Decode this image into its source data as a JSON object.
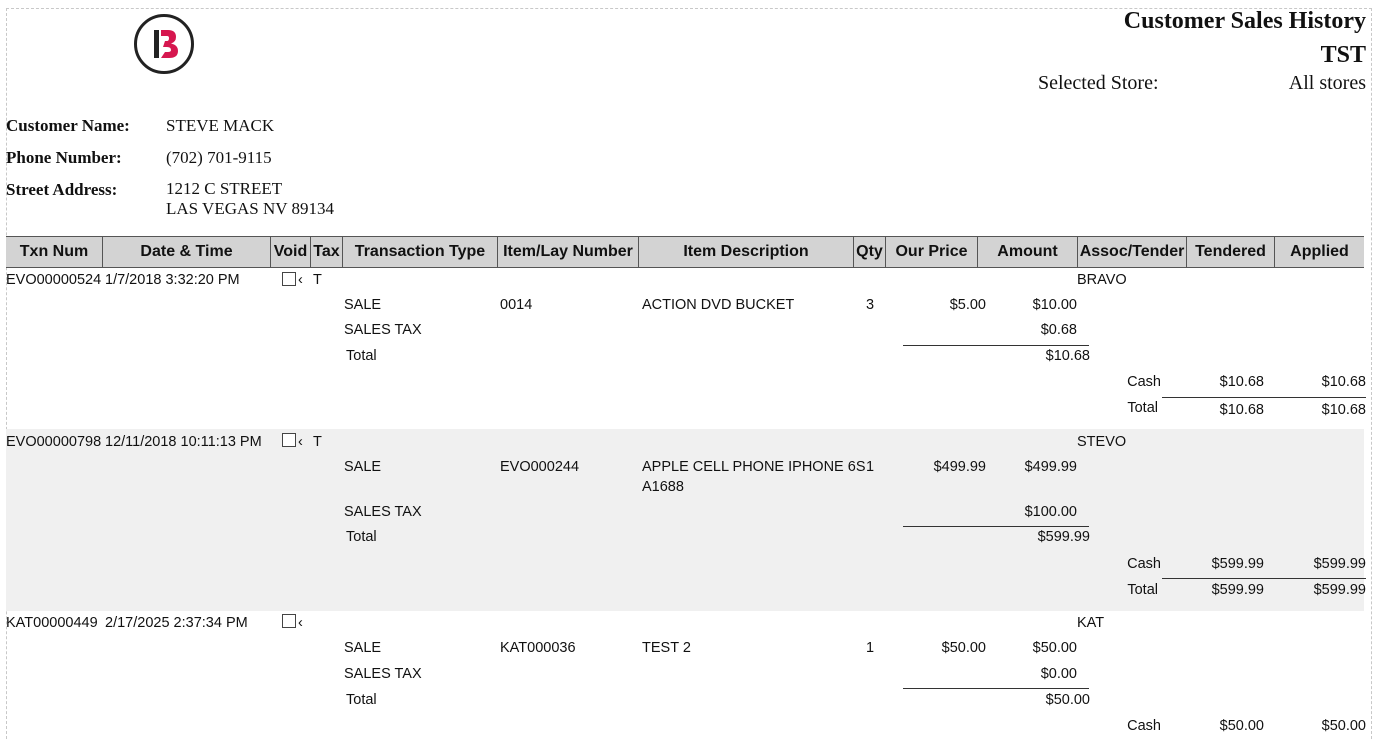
{
  "report": {
    "title": "Customer Sales History",
    "subtitle": "TST",
    "store_label": "Selected Store:",
    "store_value": "All stores"
  },
  "customer": {
    "name_label": "Customer Name:",
    "name": "STEVE MACK",
    "phone_label": "Phone Number:",
    "phone": "(702) 701-9115",
    "address_label": "Street Address:",
    "address_line1": "1212 C STREET",
    "address_line2": "LAS VEGAS NV 89134"
  },
  "columns": [
    "Txn Num",
    "Date & Time",
    "Void",
    "Tax",
    "Transaction Type",
    "Item/Lay Number",
    "Item Description",
    "Qty",
    "Our Price",
    "Amount",
    "Assoc/Tender",
    "Tendered",
    "Applied"
  ],
  "transactions": [
    {
      "txn": "EVO00000524",
      "datetime": "1/7/2018 3:32:20 PM",
      "checkmark": "‹",
      "tax": "T",
      "assoc": "BRAVO",
      "sale_type": "SALE",
      "item_number": "0014",
      "desc1": "ACTION DVD BUCKET",
      "desc2": "",
      "qty": "3",
      "price": "$5.00",
      "amount": "$10.00",
      "tax_label": "SALES TAX",
      "tax_amount": "$0.68",
      "total_label": "Total",
      "total": "$10.68",
      "tender": "Cash",
      "tendered": "$10.68",
      "applied": "$10.68",
      "tender_total_label": "Total",
      "tendered_total": "$10.68",
      "applied_total": "$10.68"
    },
    {
      "txn": "EVO00000798",
      "datetime": "12/11/2018 10:11:13 PM",
      "checkmark": "‹",
      "tax": "T",
      "assoc": "STEVO",
      "sale_type": "SALE",
      "item_number": "EVO000244",
      "desc1": "APPLE CELL PHONE IPHONE 6S",
      "desc2": "A1688",
      "qty": "1",
      "price": "$499.99",
      "amount": "$499.99",
      "tax_label": "SALES TAX",
      "tax_amount": "$100.00",
      "total_label": "Total",
      "total": "$599.99",
      "tender": "Cash",
      "tendered": "$599.99",
      "applied": "$599.99",
      "tender_total_label": "Total",
      "tendered_total": "$599.99",
      "applied_total": "$599.99"
    },
    {
      "txn": "KAT00000449",
      "datetime": "2/17/2025 2:37:34 PM",
      "checkmark": "‹",
      "tax": "",
      "assoc": "KAT",
      "sale_type": "SALE",
      "item_number": "KAT000036",
      "desc1": "TEST 2",
      "desc2": "",
      "qty": "1",
      "price": "$50.00",
      "amount": "$50.00",
      "tax_label": "SALES TAX",
      "tax_amount": "$0.00",
      "total_label": "Total",
      "total": "$50.00",
      "tender": "Cash",
      "tendered": "$50.00",
      "applied": "$50.00"
    }
  ],
  "colors": {
    "header_bg": "#d3d3d3",
    "band_bg": "#f0f0f0",
    "logo_accent": "#d6174f"
  }
}
